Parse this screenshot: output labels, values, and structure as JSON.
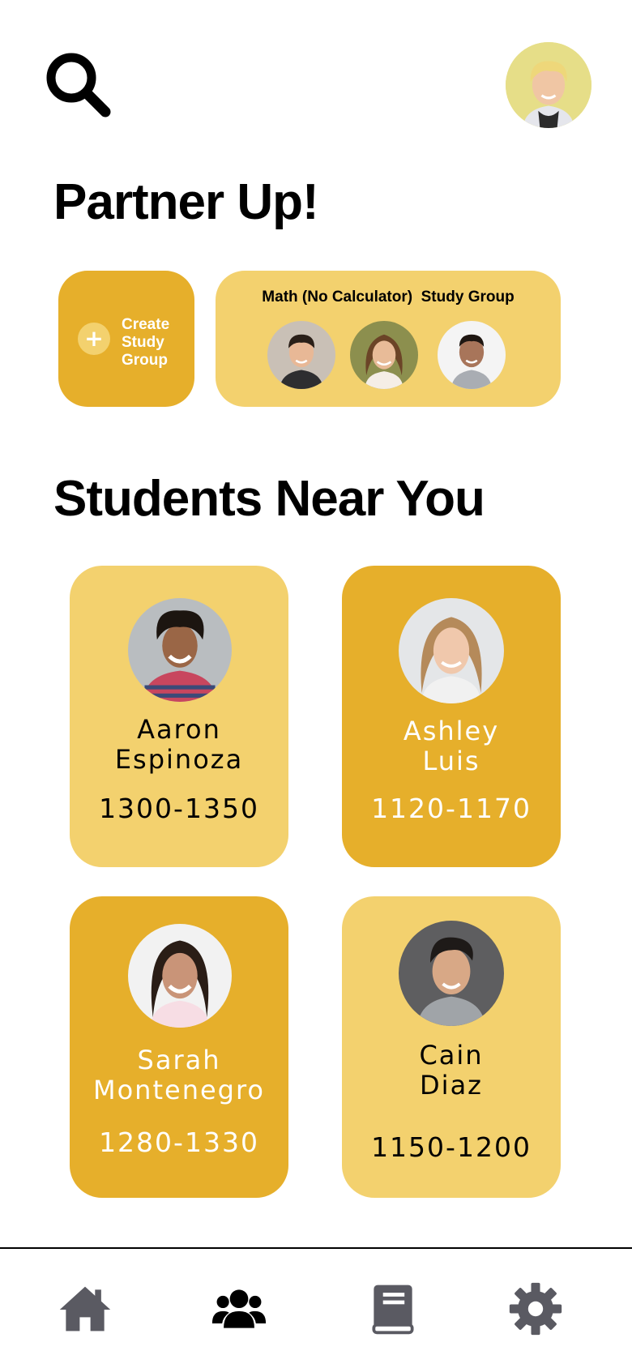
{
  "header": {
    "search_icon": "search-icon",
    "profile_icon": "avatar"
  },
  "partner": {
    "title": "Partner Up!",
    "create_label_lines": [
      "Create",
      "Study",
      "Group"
    ],
    "group_name": "Math (No Calculator)  Study Group"
  },
  "students": {
    "title": "Students Near You",
    "items": [
      {
        "first": "Aaron",
        "last": "Espinoza",
        "score": "1300-1350"
      },
      {
        "first": "Ashley",
        "last": "Luis",
        "score": "1120-1170"
      },
      {
        "first": "Sarah",
        "last": "Montenegro",
        "score": "1280-1330"
      },
      {
        "first": "Cain",
        "last": "Diaz",
        "score": "1150-1200"
      }
    ]
  },
  "nav": {
    "items": [
      "home-icon",
      "users-icon",
      "book-icon",
      "gear-icon"
    ],
    "active": "users-icon"
  },
  "colors": {
    "light": "#F3D16E",
    "dark": "#E6AF2B",
    "nav_icon": "#5A5A62"
  }
}
